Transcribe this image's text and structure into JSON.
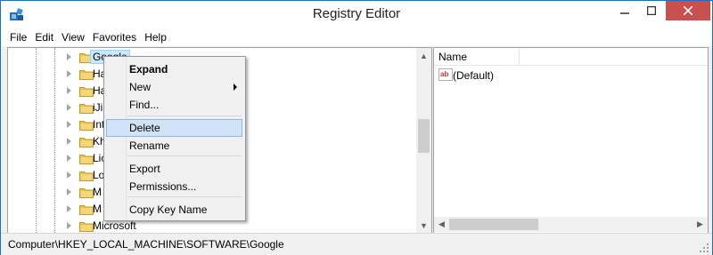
{
  "window": {
    "title": "Registry Editor"
  },
  "menubar": {
    "items": [
      "File",
      "Edit",
      "View",
      "Favorites",
      "Help"
    ]
  },
  "tree": {
    "items": [
      {
        "label": "Google",
        "selected": true
      },
      {
        "label": "Ha"
      },
      {
        "label": "Ha"
      },
      {
        "label": "iJia"
      },
      {
        "label": "Int"
      },
      {
        "label": "Kh"
      },
      {
        "label": "Lic"
      },
      {
        "label": "Lo"
      },
      {
        "label": "M"
      },
      {
        "label": "M"
      },
      {
        "label": "Microsoft"
      }
    ]
  },
  "values": {
    "column_name": "Name",
    "rows": [
      {
        "name": "(Default)",
        "icon": "string-value-icon"
      }
    ]
  },
  "context_menu": {
    "items": [
      {
        "label": "Expand",
        "bold": true
      },
      {
        "label": "New",
        "submenu": true
      },
      {
        "label": "Find..."
      },
      {
        "label": "Delete",
        "highlighted": true
      },
      {
        "label": "Rename"
      },
      {
        "label": "Export"
      },
      {
        "label": "Permissions..."
      },
      {
        "label": "Copy Key Name"
      }
    ]
  },
  "statusbar": {
    "path": "Computer\\HKEY_LOCAL_MACHINE\\SOFTWARE\\Google"
  },
  "colors": {
    "close_button": "#c75050",
    "selection": "#cce8ff",
    "menu_highlight": "#d1e3f7",
    "folder": "#e8c14c"
  }
}
